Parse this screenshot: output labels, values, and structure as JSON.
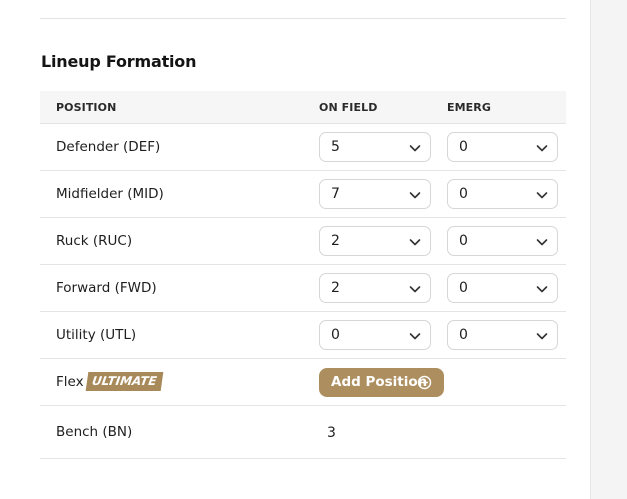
{
  "section_title": "Lineup Formation",
  "columns": {
    "position": "POSITION",
    "on_field": "ON FIELD",
    "emerg": "EMERG"
  },
  "rows": [
    {
      "label": "Defender (DEF)",
      "on_field": "5",
      "emerg": "0"
    },
    {
      "label": "Midfielder (MID)",
      "on_field": "7",
      "emerg": "0"
    },
    {
      "label": "Ruck (RUC)",
      "on_field": "2",
      "emerg": "0"
    },
    {
      "label": "Forward (FWD)",
      "on_field": "2",
      "emerg": "0"
    },
    {
      "label": "Utility (UTL)",
      "on_field": "0",
      "emerg": "0"
    }
  ],
  "flex": {
    "label": "Flex",
    "badge": "ULTIMATE",
    "button_label": "Add Position",
    "button_icon": "plus-circle-icon"
  },
  "bench": {
    "label": "Bench (BN)",
    "value": "3"
  },
  "colors": {
    "accent": "#ad8e5e",
    "header_bg": "#f6f6f6",
    "border": "#e4e4e4"
  }
}
